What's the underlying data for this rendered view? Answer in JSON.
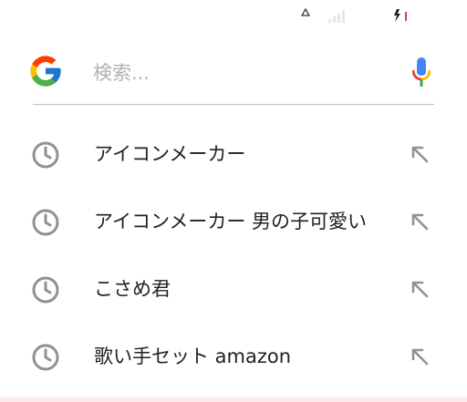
{
  "search": {
    "placeholder": "検索...",
    "value": ""
  },
  "suggestions": [
    {
      "text": "アイコンメーカー",
      "icon": "history-icon",
      "action_icon": "fill-query-arrow-icon"
    },
    {
      "text": "アイコンメーカー 男の子可愛い",
      "icon": "history-icon",
      "action_icon": "fill-query-arrow-icon"
    },
    {
      "text": "こさめ君",
      "icon": "history-icon",
      "action_icon": "fill-query-arrow-icon"
    },
    {
      "text": "歌い手セット amazon",
      "icon": "history-icon",
      "action_icon": "fill-query-arrow-icon"
    }
  ],
  "icons": {
    "logo": "google-g-logo",
    "voice": "microphone-icon",
    "status": [
      "alarm-icon",
      "signal-icon",
      "battery-charging-icon"
    ]
  },
  "colors": {
    "google_blue": "#4285F4",
    "google_red": "#EA4335",
    "google_yellow": "#FBBC05",
    "google_green": "#34A853",
    "icon_gray": "#8e9297",
    "text": "#202124",
    "placeholder": "#b3b3b3",
    "battery_low": "#e53935"
  }
}
